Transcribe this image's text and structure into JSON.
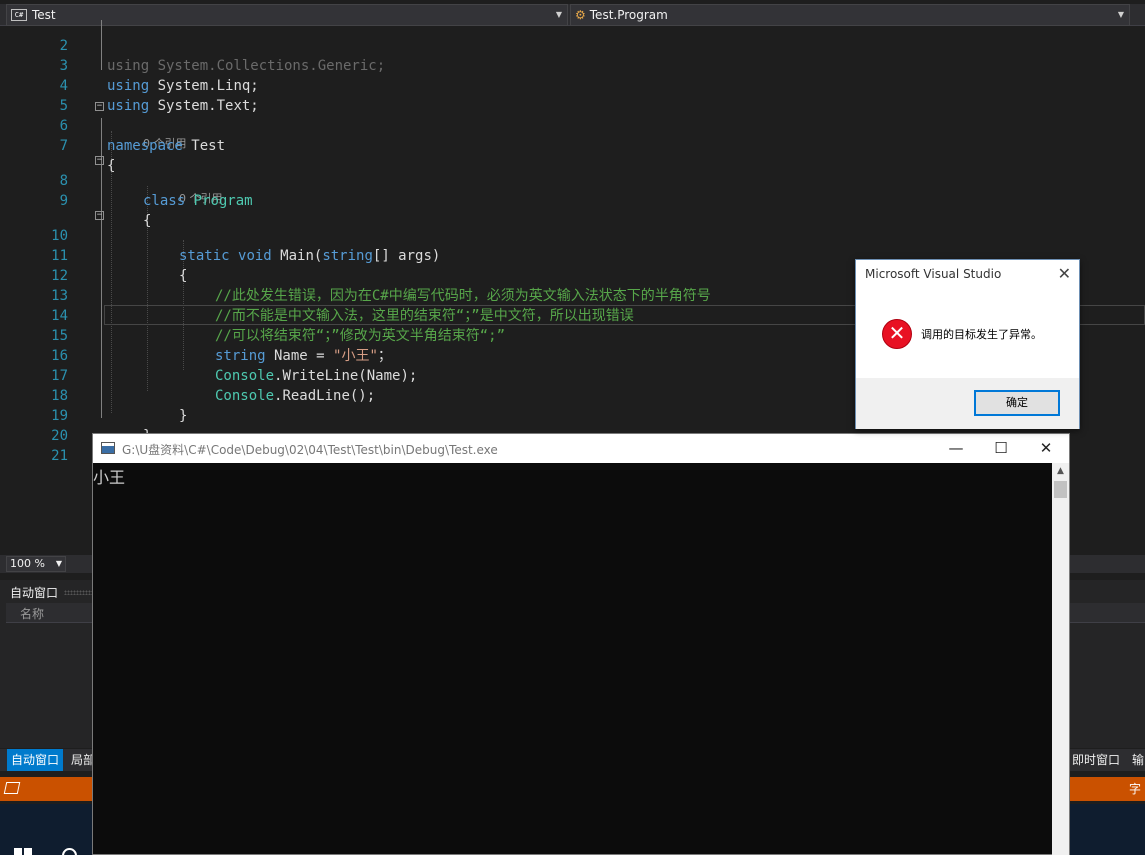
{
  "nav": {
    "project": "Test",
    "member": "Test.Program"
  },
  "editor": {
    "lines": [
      {
        "n": "2",
        "t": "using System.Collections.Generic;"
      },
      {
        "n": "3",
        "t": "using System.Linq;"
      },
      {
        "n": "4",
        "t": "using System.Text;"
      },
      {
        "n": "5",
        "t": ""
      },
      {
        "n": "6",
        "t": "namespace Test"
      },
      {
        "n": "7",
        "t": "{"
      },
      {
        "n": "8",
        "t": "class Program"
      },
      {
        "n": "9",
        "t": "{"
      },
      {
        "n": "10",
        "t": "static void Main(string[] args)"
      },
      {
        "n": "11",
        "t": "{"
      },
      {
        "n": "12",
        "t": "//此处发生错误，因为在C#中编写代码时，必须为英文输入法状态下的半角符号"
      },
      {
        "n": "13",
        "t": "//而不能是中文输入法，这里的结束符“；”是中文符，所以出现错误"
      },
      {
        "n": "14",
        "t": "//可以将结束符“；”修改为英文半角结束符“;”"
      },
      {
        "n": "15",
        "t": "string Name = \"小王\"；"
      },
      {
        "n": "16",
        "t": "Console.WriteLine(Name);"
      },
      {
        "n": "17",
        "t": "Console.ReadLine();"
      },
      {
        "n": "18",
        "t": "}"
      },
      {
        "n": "19",
        "t": "}"
      },
      {
        "n": "20",
        "t": "}"
      },
      {
        "n": "21",
        "t": ""
      }
    ],
    "codelens": "0 个引用"
  },
  "zoom": "100 %",
  "panel": {
    "title": "自动窗口",
    "column": "名称"
  },
  "bottom_tabs": [
    "自动窗口",
    "局部",
    "即时窗口",
    "输"
  ],
  "status_right": "字",
  "console": {
    "path": "G:\\U盘资料\\C#\\Code\\Debug\\02\\04\\Test\\Test\\bin\\Debug\\Test.exe",
    "output": "小王",
    "minimize": "—",
    "maximize": "☐",
    "close": "✕"
  },
  "dialog": {
    "title": "Microsoft Visual Studio",
    "message": "调用的目标发生了异常。",
    "ok": "确定",
    "close": "✕"
  },
  "colors": {
    "accent": "#007acc",
    "status": "#ca5100",
    "error": "#e81123"
  }
}
